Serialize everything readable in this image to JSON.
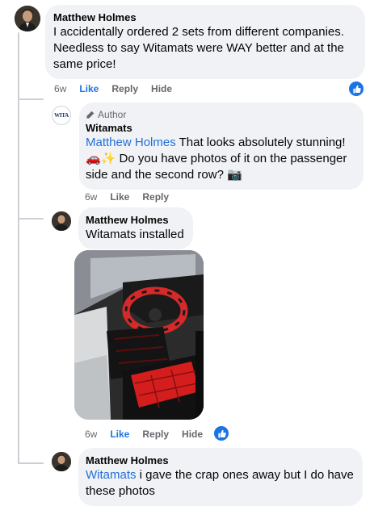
{
  "comments": [
    {
      "author": "Matthew Holmes",
      "text": "I accidentally ordered 2 sets from different companies. Needless to say Witamats were WAY better and at the same price!",
      "time": "6w",
      "like": "Like",
      "reply": "Reply",
      "hide": "Hide"
    },
    {
      "author_badge": "Author",
      "author": "Witamats",
      "mention": "Matthew Holmes",
      "text": " That looks absolutely stunning! 🚗✨ Do you have photos of it on the passenger side and the second row? 📷",
      "time": "6w",
      "like": "Like",
      "reply": "Reply",
      "avatar_logo_text": "WITA"
    },
    {
      "author": "Matthew Holmes",
      "text": "Witamats installed",
      "time": "6w",
      "like": "Like",
      "reply": "Reply",
      "hide": "Hide"
    },
    {
      "author": "Matthew Holmes",
      "mention": "Witamats",
      "text": " i gave the crap ones away but I do have these photos"
    }
  ],
  "colors": {
    "bubble": "#f0f2f5",
    "link": "#216fdb",
    "like_active": "#1b74e4",
    "meta": "#65676b"
  }
}
